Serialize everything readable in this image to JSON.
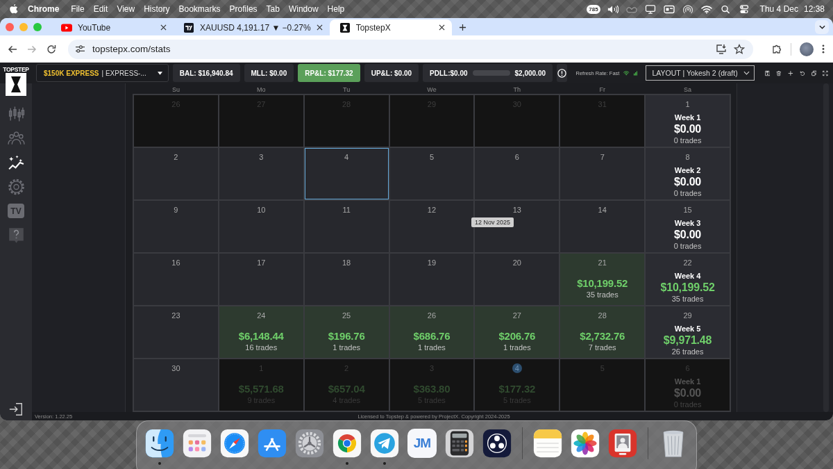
{
  "menu_bar": {
    "app_name": "Chrome",
    "menus": [
      "File",
      "Edit",
      "View",
      "History",
      "Bookmarks",
      "Profiles",
      "Tab",
      "Window",
      "Help"
    ],
    "badge": "785",
    "date": "Thu 4 Dec",
    "time": "12:38"
  },
  "browser": {
    "tabs": [
      {
        "kind": "play",
        "title": "YouTube",
        "selected": false
      },
      {
        "kind": "chart",
        "title": "XAUUSD 4,191.17 ▼ −0.27%",
        "selected": false
      },
      {
        "kind": "x",
        "title": "TopstepX",
        "selected": true
      }
    ],
    "url": "topstepx.com/stats"
  },
  "topbar": {
    "logo": "TOPSTEP",
    "account": {
      "plan": "$150K EXPRESS",
      "name": "| EXPRESS-..."
    },
    "stats": [
      {
        "text": "BAL: $16,940.84",
        "highlighted": false
      },
      {
        "text": "MLL: $0.00",
        "highlighted": false
      },
      {
        "text": "RP&L: $177.32",
        "highlighted": true
      },
      {
        "text": "UP&L: $0.00",
        "highlighted": false
      }
    ],
    "drawdown": {
      "label": "PDLL:$0.00",
      "level": 0,
      "limit": "$2,000.00"
    },
    "refresh_rate": "Refresh Rate: Fast",
    "layout": "LAYOUT | Yokesh 2 (draft)"
  },
  "sidebar": {
    "items": [
      {
        "kind": "candles",
        "selected": false
      },
      {
        "kind": "people",
        "selected": false
      },
      {
        "kind": "analytics",
        "selected": true
      },
      {
        "kind": "settings",
        "selected": false
      },
      {
        "kind": "tv",
        "label": "TV",
        "selected": false
      },
      {
        "kind": "help",
        "selected": false
      }
    ]
  },
  "calendar": {
    "weekdays": [
      "Su",
      "Mo",
      "Tu",
      "We",
      "Th",
      "Fr",
      "Sa"
    ],
    "tooltip": "12 Nov 2025",
    "weeks": [
      {
        "days": [
          {
            "day": "26",
            "kind": "other",
            "selected": false,
            "today": false
          },
          {
            "day": "27",
            "kind": "other",
            "selected": false,
            "today": false
          },
          {
            "day": "28",
            "kind": "other",
            "selected": false,
            "today": false
          },
          {
            "day": "29",
            "kind": "other",
            "selected": false,
            "today": false
          },
          {
            "day": "30",
            "kind": "other",
            "selected": false,
            "today": false
          },
          {
            "day": "31",
            "kind": "other",
            "selected": false,
            "today": false
          }
        ],
        "summary": {
          "day": "1",
          "kind": "current",
          "label": "Week 1",
          "amount": "$0.00",
          "trades": "0 trades",
          "profit": false
        }
      },
      {
        "days": [
          {
            "day": "2",
            "kind": "current",
            "selected": false,
            "today": false
          },
          {
            "day": "3",
            "kind": "current",
            "selected": false,
            "today": false
          },
          {
            "day": "4",
            "kind": "current",
            "selected": true,
            "today": false
          },
          {
            "day": "5",
            "kind": "current",
            "selected": false,
            "today": false
          },
          {
            "day": "6",
            "kind": "current",
            "selected": false,
            "today": false
          },
          {
            "day": "7",
            "kind": "current",
            "selected": false,
            "today": false
          }
        ],
        "summary": {
          "day": "8",
          "kind": "current",
          "label": "Week 2",
          "amount": "$0.00",
          "trades": "0 trades",
          "profit": false
        }
      },
      {
        "days": [
          {
            "day": "9",
            "kind": "current",
            "selected": false,
            "today": false
          },
          {
            "day": "10",
            "kind": "current",
            "selected": false,
            "today": false
          },
          {
            "day": "11",
            "kind": "current",
            "selected": false,
            "today": false
          },
          {
            "day": "12",
            "kind": "current",
            "selected": false,
            "today": false
          },
          {
            "day": "13",
            "kind": "current",
            "selected": false,
            "today": false
          },
          {
            "day": "14",
            "kind": "current",
            "selected": false,
            "today": false
          }
        ],
        "summary": {
          "day": "15",
          "kind": "current",
          "label": "Week 3",
          "amount": "$0.00",
          "trades": "0 trades",
          "profit": false
        }
      },
      {
        "days": [
          {
            "day": "16",
            "kind": "current",
            "selected": false,
            "today": false
          },
          {
            "day": "17",
            "kind": "current",
            "selected": false,
            "today": false
          },
          {
            "day": "18",
            "kind": "current",
            "selected": false,
            "today": false
          },
          {
            "day": "19",
            "kind": "current",
            "selected": false,
            "today": false
          },
          {
            "day": "20",
            "kind": "current",
            "selected": false,
            "today": false
          },
          {
            "day": "21",
            "kind": "current",
            "selected": false,
            "today": false,
            "amount": "$10,199.52",
            "trades": "35 trades"
          }
        ],
        "summary": {
          "day": "22",
          "kind": "current",
          "label": "Week 4",
          "amount": "$10,199.52",
          "trades": "35 trades",
          "profit": true
        }
      },
      {
        "days": [
          {
            "day": "23",
            "kind": "current",
            "selected": false,
            "today": false
          },
          {
            "day": "24",
            "kind": "current",
            "selected": false,
            "today": false,
            "amount": "$6,148.44",
            "trades": "16 trades"
          },
          {
            "day": "25",
            "kind": "current",
            "selected": false,
            "today": false,
            "amount": "$196.76",
            "trades": "1 trades"
          },
          {
            "day": "26",
            "kind": "current",
            "selected": false,
            "today": false,
            "amount": "$686.76",
            "trades": "1 trades"
          },
          {
            "day": "27",
            "kind": "current",
            "selected": false,
            "today": false,
            "amount": "$206.76",
            "trades": "1 trades"
          },
          {
            "day": "28",
            "kind": "current",
            "selected": false,
            "today": false,
            "amount": "$2,732.76",
            "trades": "7 trades"
          }
        ],
        "summary": {
          "day": "29",
          "kind": "current",
          "label": "Week 5",
          "amount": "$9,971.48",
          "trades": "26 trades",
          "profit": true
        }
      },
      {
        "days": [
          {
            "day": "30",
            "kind": "current",
            "selected": false,
            "today": false
          },
          {
            "day": "1",
            "kind": "other",
            "selected": false,
            "today": false,
            "amount": "$5,571.68",
            "trades": "9 trades"
          },
          {
            "day": "2",
            "kind": "other",
            "selected": false,
            "today": false,
            "amount": "$657.04",
            "trades": "4 trades"
          },
          {
            "day": "3",
            "kind": "other",
            "selected": false,
            "today": false,
            "amount": "$363.80",
            "trades": "5 trades"
          },
          {
            "day": "4",
            "kind": "other",
            "selected": false,
            "today": true,
            "amount": "$177.32",
            "trades": "5 trades"
          },
          {
            "day": "5",
            "kind": "other",
            "selected": false,
            "today": false
          }
        ],
        "summary": {
          "day": "6",
          "kind": "other",
          "label": "Week 1",
          "amount": "$0.00",
          "trades": "0 trades",
          "profit": false
        }
      }
    ]
  },
  "footer": {
    "version": "Version: 1.22.25",
    "license": "Licensed to Topstep & powered by ProjectX. Copyright 2024-2025"
  },
  "dock": {
    "groups": [
      {
        "items": [
          {
            "kind": "finder",
            "running": true
          },
          {
            "kind": "launchpad",
            "running": false
          },
          {
            "kind": "safari",
            "running": false
          },
          {
            "kind": "appstore",
            "running": false
          },
          {
            "kind": "settings",
            "running": false
          },
          {
            "kind": "chrome",
            "running": true
          },
          {
            "kind": "telegram",
            "running": true
          },
          {
            "kind": "jm",
            "label": "JM",
            "running": false
          },
          {
            "kind": "calculator",
            "running": false
          },
          {
            "kind": "obs",
            "running": false
          }
        ]
      },
      {
        "items": [
          {
            "kind": "notes",
            "running": false
          },
          {
            "kind": "photos",
            "running": false
          },
          {
            "kind": "booth",
            "running": false
          }
        ]
      },
      {
        "items": [
          {
            "kind": "trash",
            "running": false
          }
        ]
      }
    ]
  }
}
